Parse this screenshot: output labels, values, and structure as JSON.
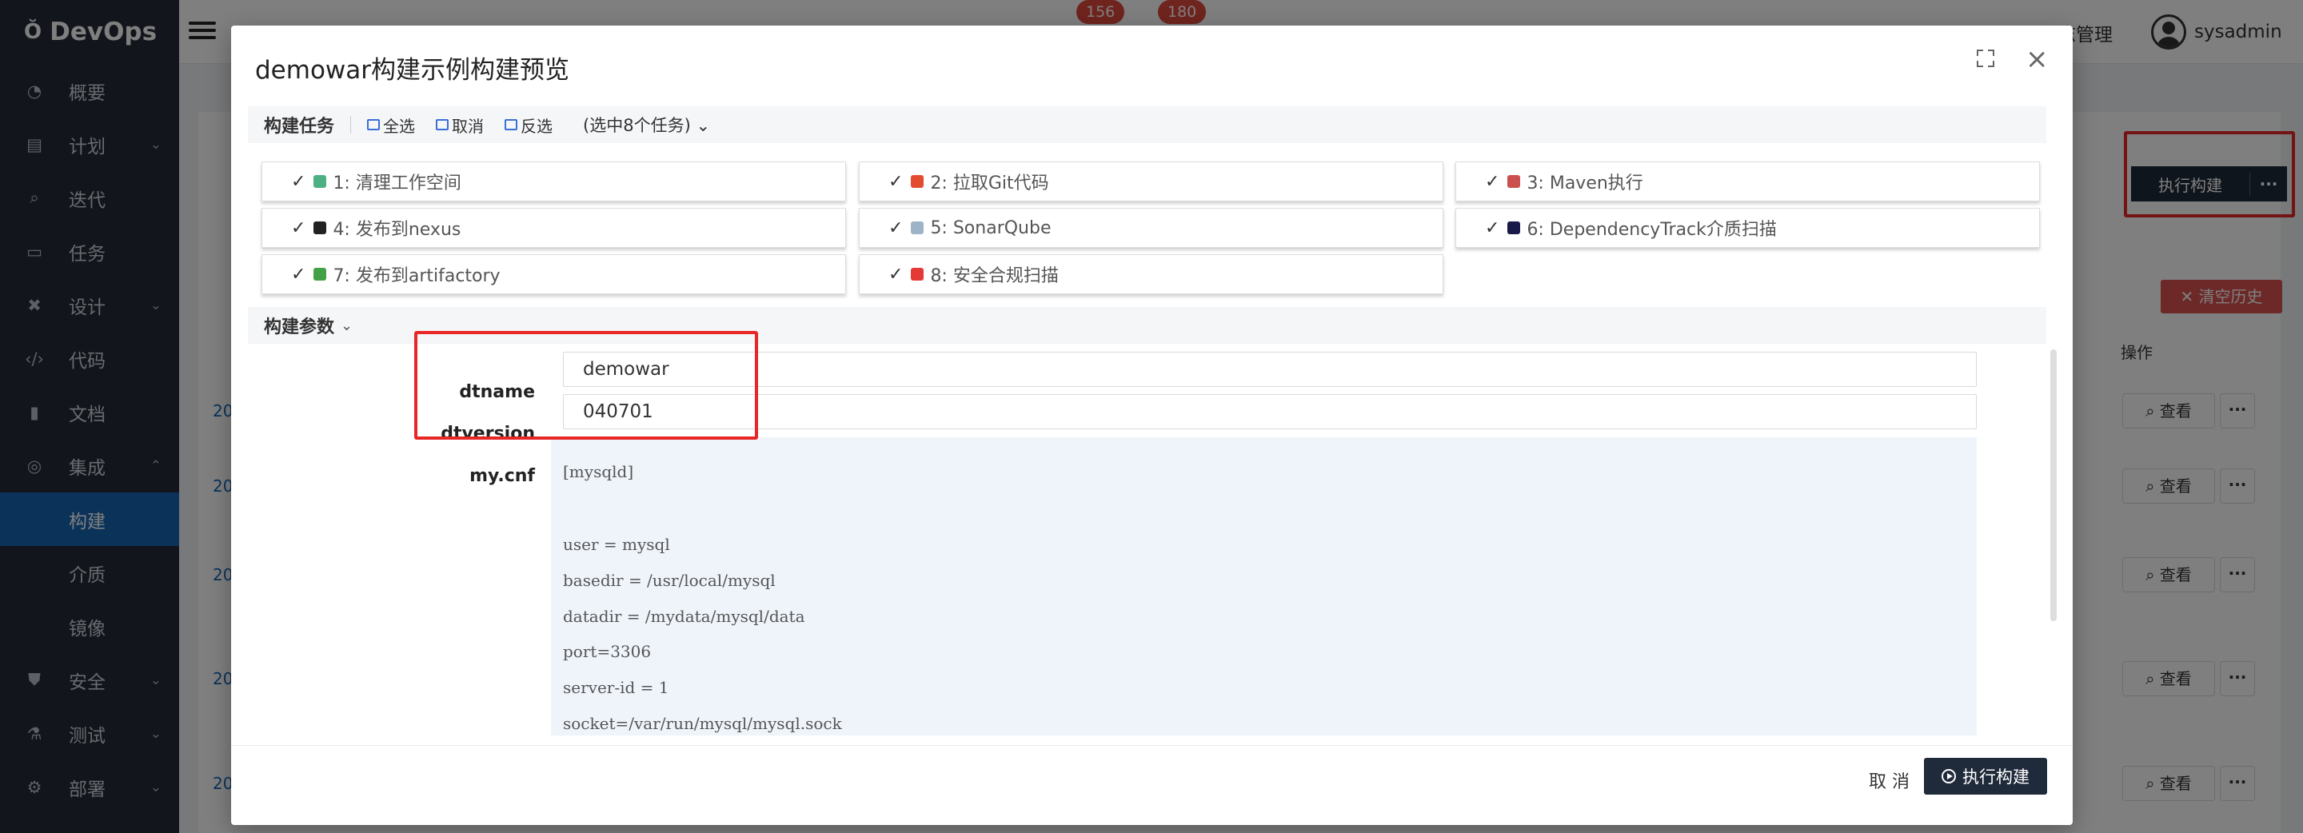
{
  "app": {
    "logo": "DevOps"
  },
  "sidebar": {
    "items": [
      {
        "label": "概要",
        "icon": "dashboard-icon",
        "chev": ""
      },
      {
        "label": "计划",
        "icon": "calendar-icon",
        "chev": "⌄"
      },
      {
        "label": "迭代",
        "icon": "search-icon",
        "chev": ""
      },
      {
        "label": "任务",
        "icon": "task-icon",
        "chev": ""
      },
      {
        "label": "设计",
        "icon": "tools-icon",
        "chev": "⌄"
      },
      {
        "label": "代码",
        "icon": "code-icon",
        "chev": ""
      },
      {
        "label": "文档",
        "icon": "file-icon",
        "chev": ""
      },
      {
        "label": "集成",
        "icon": "integration-icon",
        "chev": "⌃"
      },
      {
        "label": "构建",
        "icon": "",
        "chev": ""
      },
      {
        "label": "介质",
        "icon": "",
        "chev": ""
      },
      {
        "label": "镜像",
        "icon": "",
        "chev": ""
      },
      {
        "label": "安全",
        "icon": "shield-icon",
        "chev": "⌄"
      },
      {
        "label": "测试",
        "icon": "flask-icon",
        "chev": "⌄"
      },
      {
        "label": "部署",
        "icon": "deploy-icon",
        "chev": "⌄"
      }
    ]
  },
  "topbar": {
    "badge1": "156",
    "badge2": "180",
    "menu_last": "日志管理",
    "user": "sysadmin"
  },
  "background": {
    "run_build": "执行构建",
    "more": "···",
    "clear_history": "清空历史",
    "op_header": "操作",
    "view": "查看",
    "row_prefix": "20"
  },
  "modal": {
    "title": "demowar构建示例构建预览",
    "tasks_section": {
      "label": "构建任务",
      "select_all": "全选",
      "cancel": "取消",
      "invert": "反选",
      "selected": "(选中8个任务)"
    },
    "tasks": [
      {
        "label": "1: 清理工作空间",
        "color": "#4caf86"
      },
      {
        "label": "2: 拉取Git代码",
        "color": "#e44c30"
      },
      {
        "label": "3: Maven执行",
        "color": "#c9504d"
      },
      {
        "label": "4: 发布到nexus",
        "color": "#222222"
      },
      {
        "label": "5: SonarQube",
        "color": "#9fb3c8"
      },
      {
        "label": "6: DependencyTrack介质扫描",
        "color": "#1a1a4a"
      },
      {
        "label": "7: 发布到artifactory",
        "color": "#43a047"
      },
      {
        "label": "8: 安全合规扫描",
        "color": "#e53935"
      }
    ],
    "params_section": {
      "label": "构建参数"
    },
    "params": [
      {
        "name": "dtname",
        "value": "demowar"
      },
      {
        "name": "dtversion",
        "value": "040701"
      },
      {
        "name": "my.cnf"
      }
    ],
    "cnf_lines": [
      "[mysqld]",
      "",
      "user = mysql",
      "basedir = /usr/local/mysql",
      "datadir = /mydata/mysql/data",
      "port=3306",
      "server-id = 1",
      "socket=/var/run/mysql/mysql.sock"
    ],
    "footer": {
      "cancel": "取 消",
      "exec": "执行构建"
    }
  }
}
